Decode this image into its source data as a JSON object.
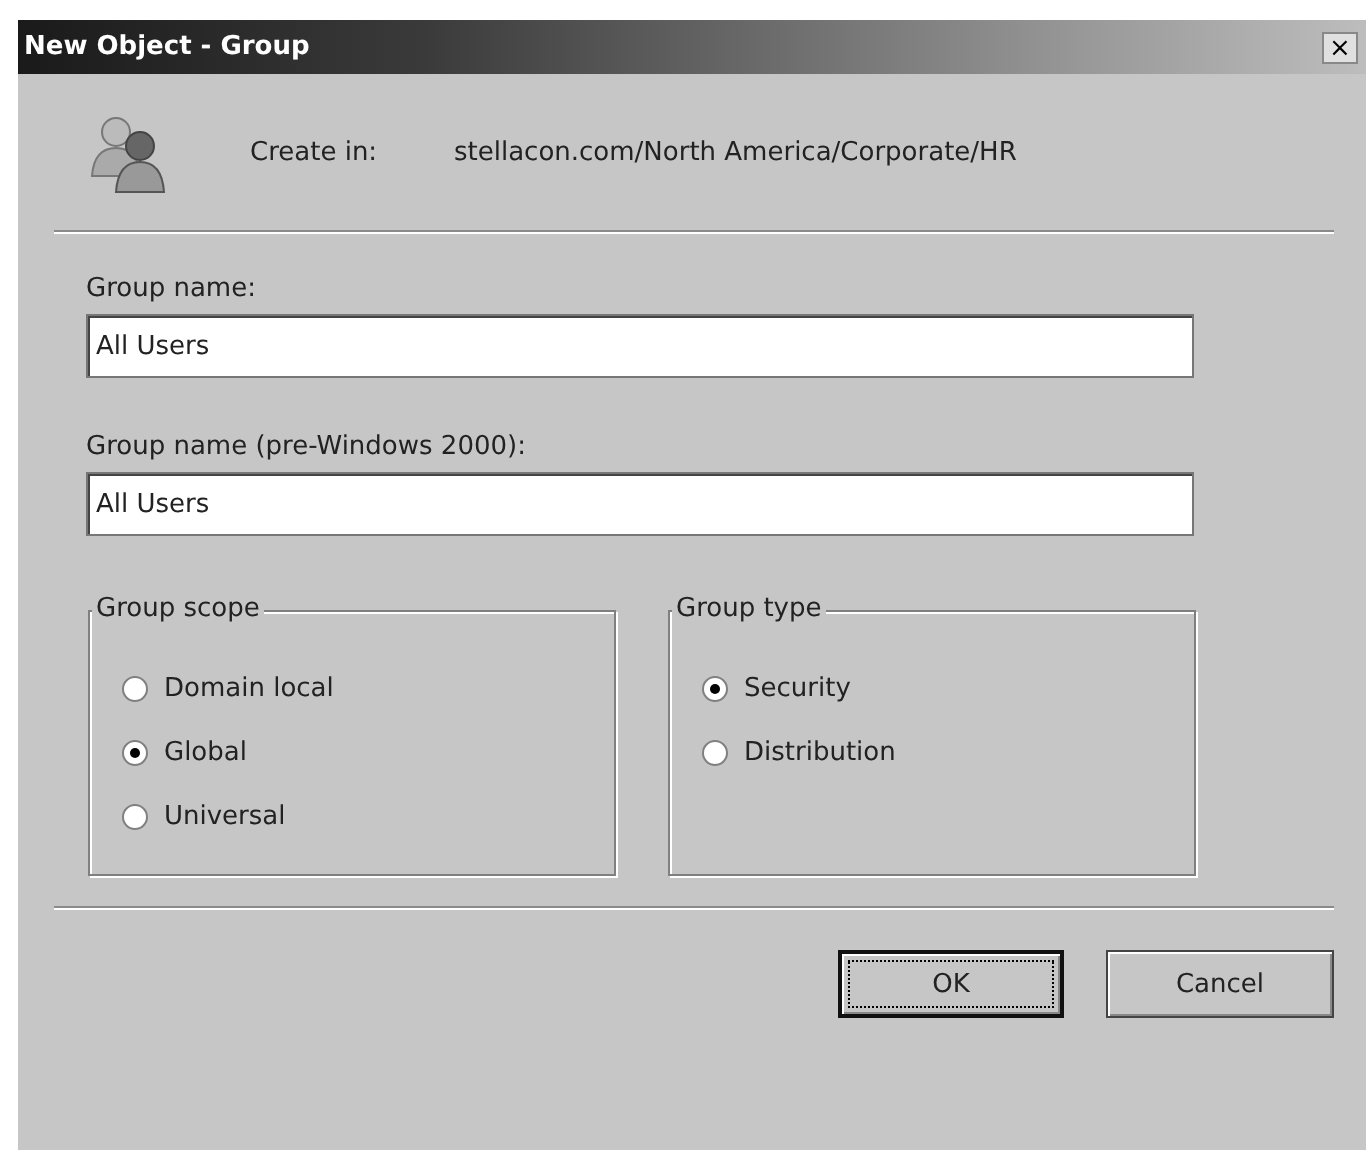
{
  "window": {
    "title": "New Object - Group",
    "close": "×"
  },
  "create_in": {
    "label": "Create in:",
    "path": "stellacon.com/North America/Corporate/HR"
  },
  "fields": [
    {
      "label": "Group name:",
      "value": "All Users"
    },
    {
      "label": "Group name (pre-Windows 2000):",
      "value": "All Users"
    }
  ],
  "option_groups": [
    {
      "title": "Group scope",
      "options": [
        {
          "label": "Domain local",
          "selected": false
        },
        {
          "label": "Global",
          "selected": true
        },
        {
          "label": "Universal",
          "selected": false
        }
      ]
    },
    {
      "title": "Group type",
      "options": [
        {
          "label": "Security",
          "selected": true
        },
        {
          "label": "Distribution",
          "selected": false
        }
      ]
    }
  ],
  "buttons": [
    {
      "label": "OK",
      "default": true
    },
    {
      "label": "Cancel",
      "default": false
    }
  ]
}
